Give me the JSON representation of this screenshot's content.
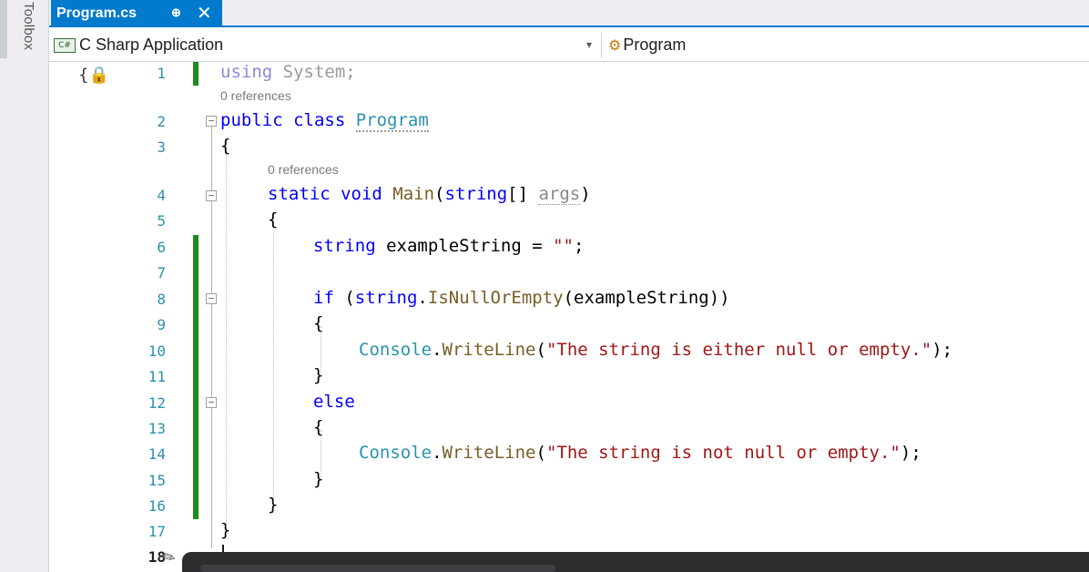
{
  "sidebar": {
    "toolbox_label": "Toolbox"
  },
  "tab": {
    "title": "Program.cs",
    "pin_glyph": "⊕",
    "close_glyph": "✕"
  },
  "nav": {
    "project": "C Sharp Application",
    "project_icon_text": "C#",
    "dropdown_glyph": "▾",
    "member": "Program",
    "member_icon": "class-icon"
  },
  "editor": {
    "line_numbers": [
      "1",
      "2",
      "3",
      "4",
      "5",
      "6",
      "7",
      "8",
      "9",
      "10",
      "11",
      "12",
      "13",
      "14",
      "15",
      "16",
      "17",
      "18"
    ],
    "current_line": "18",
    "refs": {
      "program": "0 references",
      "main": "0 references"
    },
    "code": {
      "l1_kw": "using",
      "l1_rest": " System;",
      "l2_kw": "public class ",
      "l2_type": "Program",
      "l3": "{",
      "l4_kw": "static void ",
      "l4_method": "Main",
      "l4_open": "(",
      "l4_kw2": "string",
      "l4_mid": "[] ",
      "l4_param": "args",
      "l4_close": ")",
      "l5": "{",
      "l6_kw": "string",
      "l6_mid": " exampleString = ",
      "l6_str": "\"\"",
      "l6_end": ";",
      "l8_kw": "if",
      "l8_open": " (",
      "l8_kw2": "string",
      "l8_dot": ".",
      "l8_method": "IsNullOrEmpty",
      "l8_rest": "(exampleString))",
      "l9": "{",
      "l10_type": "Console",
      "l10_dot": ".",
      "l10_method": "WriteLine",
      "l10_open": "(",
      "l10_str": "\"The string is either null or empty.\"",
      "l10_end": ");",
      "l11": "}",
      "l12_kw": "else",
      "l13": "{",
      "l14_type": "Console",
      "l14_dot": ".",
      "l14_method": "WriteLine",
      "l14_open": "(",
      "l14_str": "\"The string is not null or empty.\"",
      "l14_end": ");",
      "l15": "}",
      "l16": "}",
      "l17": "}"
    }
  },
  "colors": {
    "accent": "#007acc",
    "keyword": "#0000ff",
    "type": "#2b91af",
    "string": "#a31515",
    "method": "#795e26",
    "change_bar": "#1e8c1e"
  }
}
